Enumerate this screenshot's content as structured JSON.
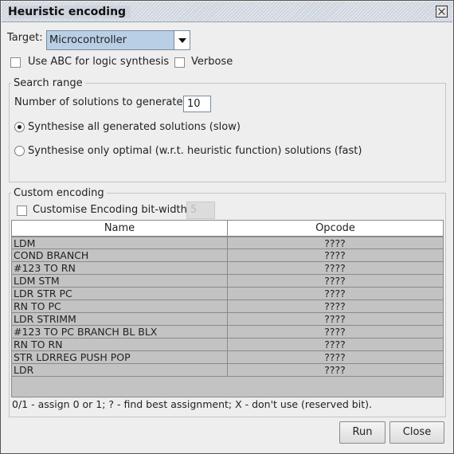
{
  "window": {
    "title": "Heuristic encoding"
  },
  "target": {
    "label": "Target:",
    "selected": "Microcontroller"
  },
  "options": {
    "abc_label": "Use ABC for logic synthesis",
    "verbose_label": "Verbose"
  },
  "search_range": {
    "legend": "Search range",
    "solutions_label": "Number of solutions to generate",
    "solutions_value": "10",
    "radio_all": "Synthesise all generated solutions (slow)",
    "radio_optimal": "Synthesise only optimal (w.r.t. heuristic function) solutions (fast)"
  },
  "custom_encoding": {
    "legend": "Custom encoding",
    "bitwidth_label": "Customise Encoding bit-width:",
    "bitwidth_value": "5",
    "columns": [
      "Name",
      "Opcode"
    ],
    "rows": [
      {
        "name": "LDM",
        "opcode": "????"
      },
      {
        "name": "COND BRANCH",
        "opcode": "????"
      },
      {
        "name": "#123 TO RN",
        "opcode": "????"
      },
      {
        "name": "LDM STM",
        "opcode": "????"
      },
      {
        "name": "LDR STR PC",
        "opcode": "????"
      },
      {
        "name": "RN TO PC",
        "opcode": "????"
      },
      {
        "name": "LDR STRIMM",
        "opcode": "????"
      },
      {
        "name": "#123 TO PC BRANCH BL BLX",
        "opcode": "????"
      },
      {
        "name": "RN TO RN",
        "opcode": "????"
      },
      {
        "name": "STR LDRREG PUSH POP",
        "opcode": "????"
      },
      {
        "name": "LDR",
        "opcode": "????"
      }
    ],
    "hint": "0/1 - assign 0 or 1;  ? - find best assignment;  X - don't use (reserved bit)."
  },
  "buttons": {
    "run": "Run",
    "close": "Close"
  }
}
